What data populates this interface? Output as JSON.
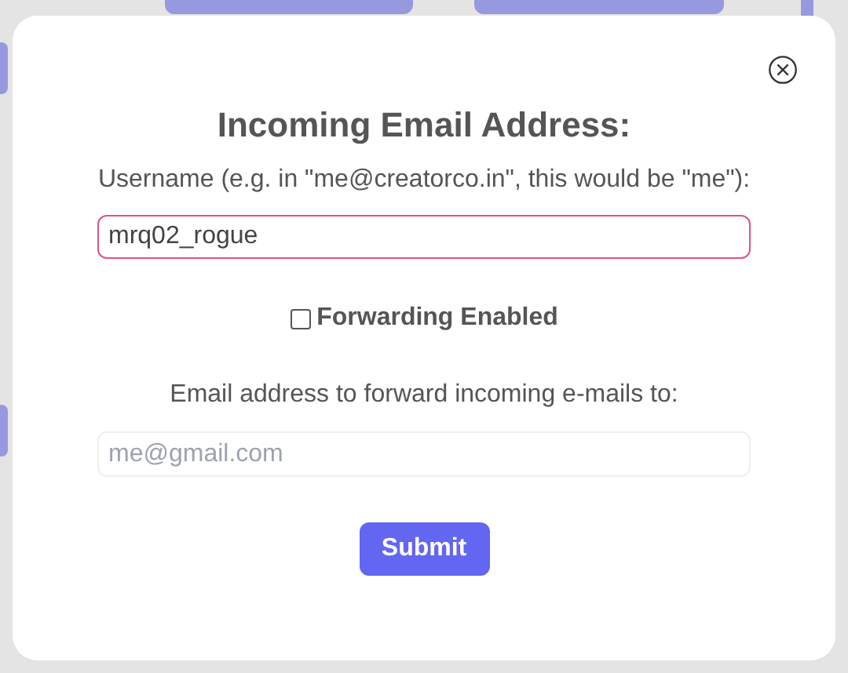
{
  "dialog": {
    "title": "Incoming Email Address:",
    "username_label": "Username (e.g. in \"me@creatorco.in\", this would be \"me\"):",
    "username_field": {
      "value": "mrq02_rogue",
      "focused": true
    },
    "forwarding": {
      "label": "Forwarding Enabled",
      "checked": false
    },
    "forward_label": "Email address to forward incoming e-mails to:",
    "forward_field": {
      "placeholder": "me@gmail.com"
    },
    "submit": "Submit"
  }
}
